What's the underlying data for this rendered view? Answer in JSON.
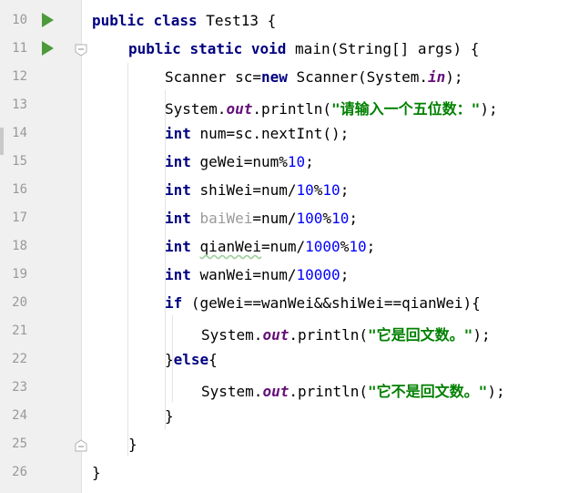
{
  "editor": {
    "line_numbers": [
      "10",
      "11",
      "12",
      "13",
      "14",
      "15",
      "16",
      "17",
      "18",
      "19",
      "20",
      "21",
      "22",
      "23",
      "24",
      "25",
      "26"
    ],
    "code": {
      "l10": {
        "kw1": "public",
        "kw2": "class",
        "rest": "Test13 {"
      },
      "l11": {
        "kw1": "public",
        "kw2": "static",
        "kw3": "void",
        "rest": "main(String[] args) {"
      },
      "l12": {
        "pre": "Scanner sc=",
        "kw": "new",
        "mid": "Scanner(System.",
        "fld": "in",
        "post": ");"
      },
      "l13": {
        "pre": "System.",
        "fld": "out",
        "mid": ".println(",
        "str": "\"请输入一个五位数：\"",
        "post": ");"
      },
      "l14": {
        "kw": "int",
        "rest": "num=sc.nextInt();"
      },
      "l15": {
        "kw": "int",
        "pre": "geWei=num%",
        "num": "10",
        "post": ";"
      },
      "l16": {
        "kw": "int",
        "pre": "shiWei=num/",
        "num1": "10",
        "mid": "%",
        "num2": "10",
        "post": ";"
      },
      "l17": {
        "kw": "int",
        "gray": "baiWei",
        "pre": "=num/",
        "num1": "100",
        "mid": "%",
        "num2": "10",
        "post": ";"
      },
      "l18": {
        "kw": "int",
        "typo": "qianWei",
        "pre": "=num/",
        "num1": "1000",
        "mid": "%",
        "num2": "10",
        "post": ";"
      },
      "l19": {
        "kw": "int",
        "pre": "wanWei=num/",
        "num": "10000",
        "post": ";"
      },
      "l20": {
        "kw": "if",
        "rest": "(geWei==wanWei&&shiWei==qianWei){"
      },
      "l21": {
        "pre": "System.",
        "fld": "out",
        "mid": ".println(",
        "str": "\"它是回文数。\"",
        "post": ");"
      },
      "l22": {
        "pre": "}",
        "kw": "else",
        "post": "{"
      },
      "l23": {
        "pre": "System.",
        "fld": "out",
        "mid": ".println(",
        "str": "\"它不是回文数。\"",
        "post": ");"
      },
      "l24": {
        "text": "}"
      },
      "l25": {
        "text": "}"
      },
      "l26": {
        "text": "}"
      }
    },
    "run_icons": [
      "run-class-icon",
      "run-main-icon"
    ],
    "fold_icons": [
      "fold-method-start-icon",
      "fold-method-end-icon"
    ],
    "colors": {
      "keyword": "#000080",
      "static_field": "#660e7a",
      "string": "#008000",
      "number": "#0000ff",
      "unused": "#9a9a9a",
      "run_icon": "#4c9a3b",
      "gutter": "#f0f0f0"
    }
  }
}
